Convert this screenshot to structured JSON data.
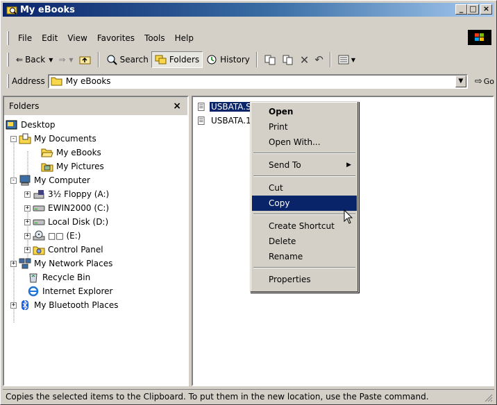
{
  "window": {
    "title": "My eBooks"
  },
  "menubar": {
    "items": [
      "File",
      "Edit",
      "View",
      "Favorites",
      "Tools",
      "Help"
    ]
  },
  "toolbar": {
    "back": "Back",
    "search": "Search",
    "folders": "Folders",
    "history": "History"
  },
  "address": {
    "label": "Address",
    "value": "My eBooks",
    "go": "Go"
  },
  "folders_pane": {
    "title": "Folders",
    "close": "×",
    "tree": [
      {
        "label": "Desktop"
      },
      {
        "label": "My Documents"
      },
      {
        "label": "My eBooks"
      },
      {
        "label": "My Pictures"
      },
      {
        "label": "My Computer"
      },
      {
        "label": "3½ Floppy (A:)"
      },
      {
        "label": "EWIN2000 (C:)"
      },
      {
        "label": "Local Disk (D:)"
      },
      {
        "label": "□□ (E:)"
      },
      {
        "label": "Control Panel"
      },
      {
        "label": "My Network Places"
      },
      {
        "label": "Recycle Bin"
      },
      {
        "label": "Internet Explorer"
      },
      {
        "label": "My Bluetooth Places"
      }
    ]
  },
  "files": [
    {
      "name": "USBATA.SYS"
    },
    {
      "name": "USBATA.1"
    }
  ],
  "context_menu": {
    "open": "Open",
    "print": "Print",
    "open_with": "Open With...",
    "send_to": "Send To",
    "cut": "Cut",
    "copy": "Copy",
    "create_shortcut": "Create Shortcut",
    "delete": "Delete",
    "rename": "Rename",
    "properties": "Properties"
  },
  "status": {
    "text": "Copies the selected items to the Clipboard. To put them in the new location, use the Paste command."
  }
}
